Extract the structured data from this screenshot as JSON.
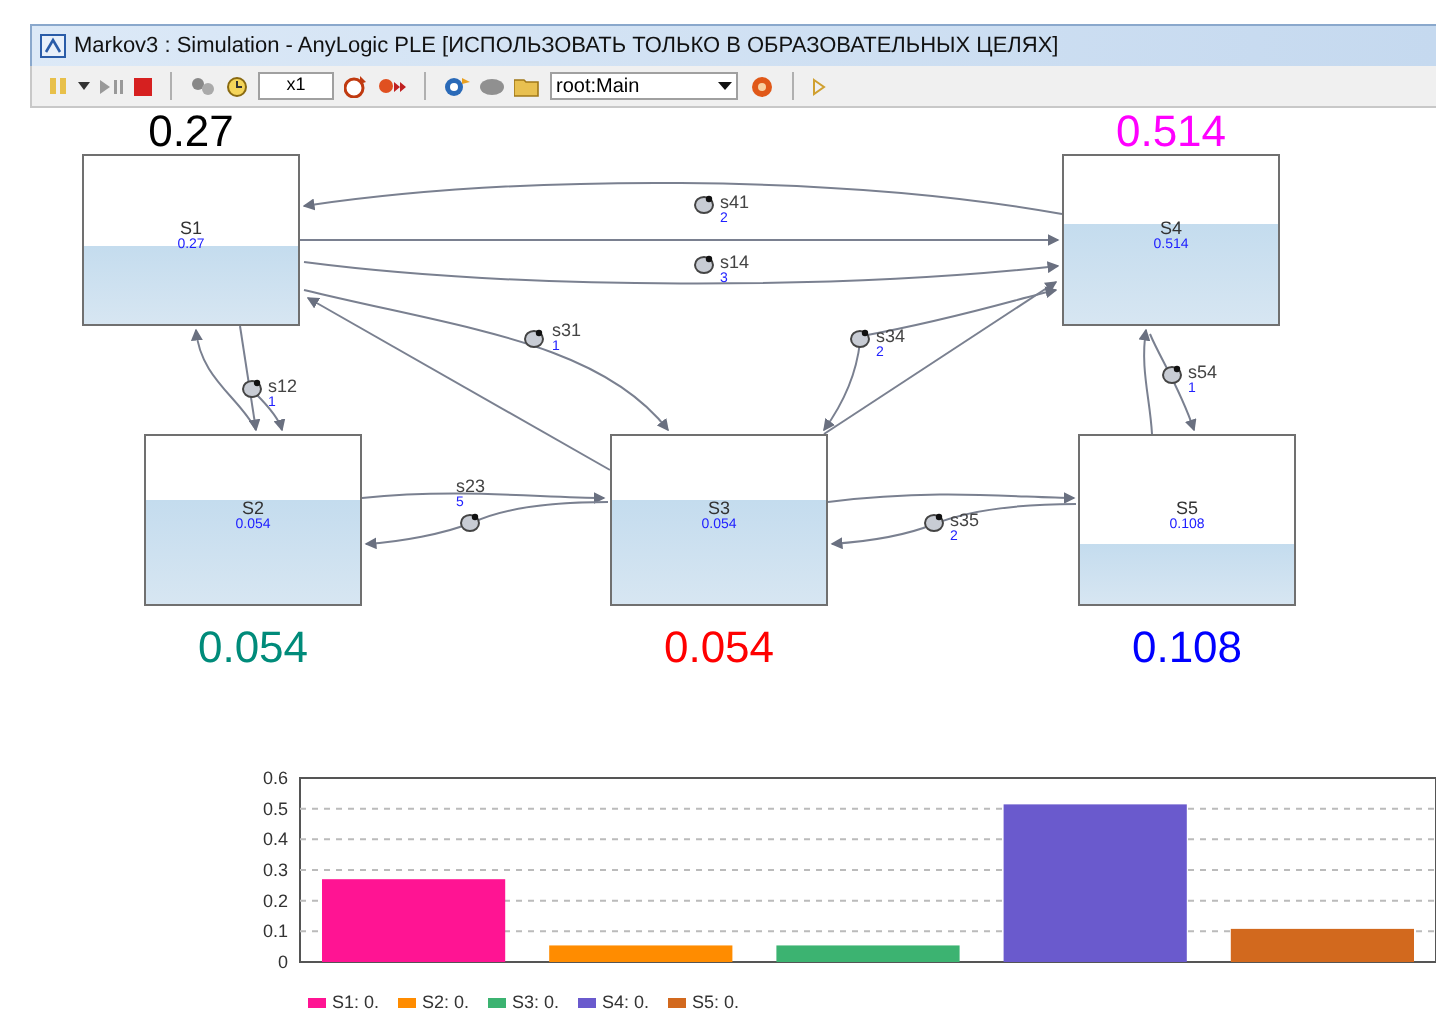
{
  "window": {
    "title": "Markov3 : Simulation - AnyLogic PLE [ИСПОЛЬЗОВАТЬ ТОЛЬКО В ОБРАЗОВАТЕЛЬНЫХ ЦЕЛЯХ]"
  },
  "toolbar": {
    "speed": "x1",
    "view": "root:Main"
  },
  "states": [
    {
      "name": "S1",
      "value": "0.27",
      "big_value": "0.27",
      "color": "#000000"
    },
    {
      "name": "S4",
      "value": "0.514",
      "big_value": "0.514",
      "color": "#ff00ff"
    },
    {
      "name": "S2",
      "value": "0.054",
      "big_value": "0.054",
      "color": "#008b7a"
    },
    {
      "name": "S3",
      "value": "0.054",
      "big_value": "0.054",
      "color": "#ff0000"
    },
    {
      "name": "S5",
      "value": "0.108",
      "big_value": "0.108",
      "color": "#0000ff"
    }
  ],
  "transitions": [
    {
      "name": "s41",
      "rate": "2"
    },
    {
      "name": "s14",
      "rate": "3"
    },
    {
      "name": "s31",
      "rate": "1"
    },
    {
      "name": "s34",
      "rate": "2"
    },
    {
      "name": "s12",
      "rate": "1"
    },
    {
      "name": "s54",
      "rate": "1"
    },
    {
      "name": "s23",
      "rate": "5"
    },
    {
      "name": "s35",
      "rate": "2"
    }
  ],
  "chart_data": {
    "type": "bar",
    "grid": true,
    "legend": true,
    "ylim": [
      0,
      0.6
    ],
    "yticks": [
      0,
      0.1,
      0.2,
      0.3,
      0.4,
      0.5,
      0.6
    ],
    "series": [
      {
        "name": "S1: 0.",
        "color": "#ff1493",
        "values": [
          0.27
        ]
      },
      {
        "name": "S2: 0.",
        "color": "#ff8c00",
        "values": [
          0.054
        ]
      },
      {
        "name": "S3: 0.",
        "color": "#3cb371",
        "values": [
          0.054
        ]
      },
      {
        "name": "S4: 0.",
        "color": "#6a5acd",
        "values": [
          0.514
        ]
      },
      {
        "name": "S5: 0.",
        "color": "#d2691e",
        "values": [
          0.108
        ]
      }
    ]
  }
}
